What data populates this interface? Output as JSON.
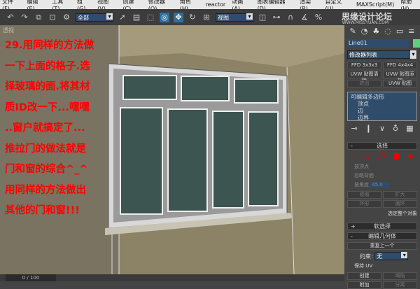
{
  "menu": [
    "文件(F)",
    "编辑(E)",
    "工具(T)",
    "组(G)",
    "视图(V)",
    "创建(C)",
    "修改器(O)",
    "角色(H)",
    "reactor",
    "动画(A)",
    "图表编辑器(D)",
    "渲染(R)",
    "自定义(U)",
    "MAXScript(M)",
    "帮助(H)"
  ],
  "toolbar": {
    "selection_filter": "全部",
    "coord_system": "视图"
  },
  "watermark": {
    "text": "思缘设计论坛",
    "url": "WWW.MISSYUAN.COM"
  },
  "viewport": {
    "label": "透视",
    "note": "29.用同样的方法做\n一下上面的格子.选\n择玻璃的面.将其材\n质ID改一下...嘿嘿\n..窗户就搞定了...\n推拉门的做法就是\n门和窗的综合^_^\n用同样的方法做出\n其他的门和窗!!!"
  },
  "timeline": {
    "frame": "0 / 100"
  },
  "panel": {
    "object_name": "Line01",
    "object_color": "#5ed17f",
    "modifier_list": "修改器列表",
    "buttons": [
      "FFD 3x3x3",
      "FFD 4x4x4",
      "UVW 贴图清除",
      "UVW 贴图添加",
      "挤出",
      "UVW 贴图"
    ],
    "stack": [
      "可编辑多边形",
      "顶点",
      "边",
      "边界"
    ],
    "selection": {
      "title": "选择",
      "by_vertex": "按顶点",
      "ignore_back": "忽略背面",
      "by_angle": "按角度",
      "angle": "45.0",
      "shrink": "收缩",
      "grow": "扩大",
      "ring": "环形",
      "loop": "循环",
      "select_all": "选定整个对象"
    },
    "soft_selection": "软选择",
    "edit_geometry": {
      "title": "编辑几何体",
      "repeat": "重复上一个",
      "constraint_label": "约束:",
      "constraint": "无",
      "preserve_uv": "保持 UV",
      "create": "创建",
      "collapse": "塌陷",
      "attach": "附加",
      "detach": "分离"
    }
  }
}
